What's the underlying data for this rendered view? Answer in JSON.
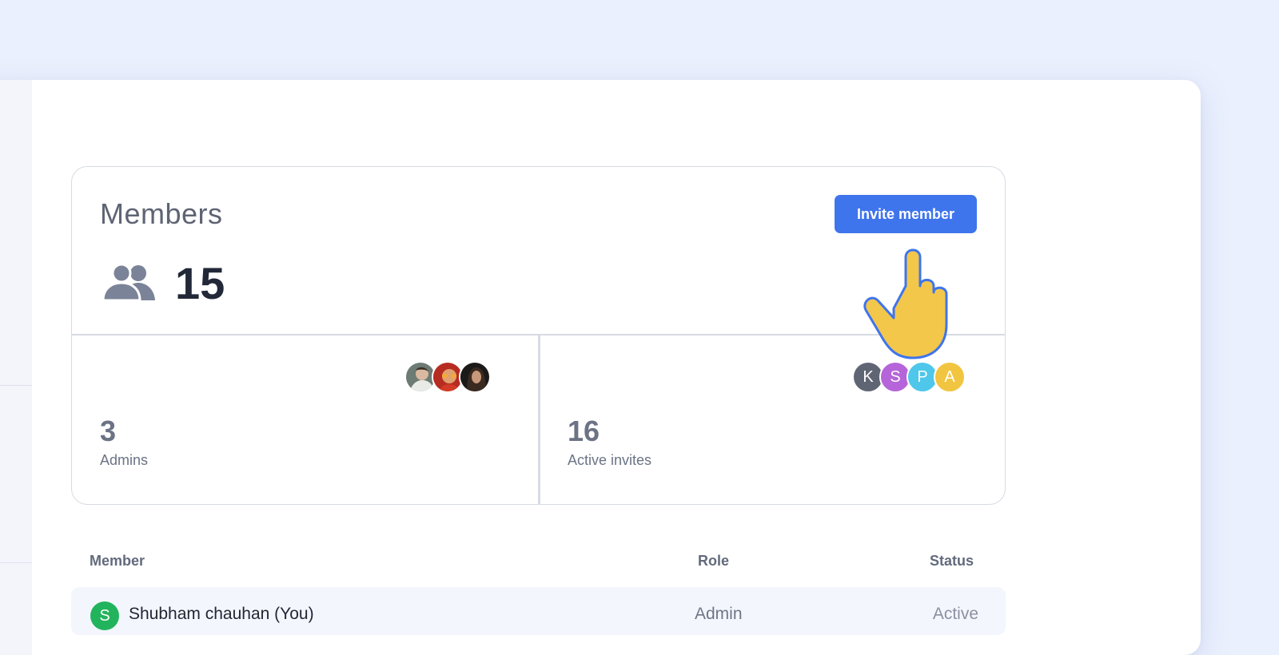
{
  "members_card": {
    "title": "Members",
    "invite_button_label": "Invite member",
    "member_count": "15",
    "admins": {
      "count": "3",
      "label": "Admins",
      "avatars": [
        "admin-photo-1",
        "admin-photo-2",
        "admin-photo-3"
      ]
    },
    "invites": {
      "count": "16",
      "label": "Active invites",
      "avatars": [
        {
          "initial": "K",
          "color": "#5f6573"
        },
        {
          "initial": "S",
          "color": "#b664d9"
        },
        {
          "initial": "P",
          "color": "#4fc7ea"
        },
        {
          "initial": "A",
          "color": "#f1c540"
        }
      ]
    }
  },
  "table": {
    "headers": {
      "member": "Member",
      "role": "Role",
      "status": "Status"
    },
    "rows": [
      {
        "initial": "S",
        "name": "Shubham chauhan (You)",
        "role": "Admin",
        "status": "Active",
        "avatar_color": "#22b45c"
      }
    ]
  },
  "colors": {
    "accent": "#3f75ec",
    "page_background": "#eaf0fd",
    "cursor_fill": "#f3c74a",
    "cursor_outline": "#3f75ec"
  },
  "icons": {
    "members": "users-icon",
    "cursor": "pointer-hand-icon"
  }
}
